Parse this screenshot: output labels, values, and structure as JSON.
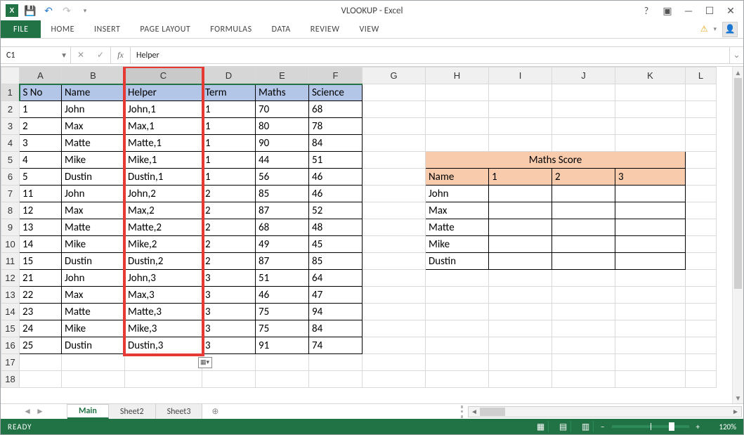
{
  "title": "VLOOKUP - Excel",
  "ribbon_tabs": {
    "file": "FILE",
    "home": "HOME",
    "insert": "INSERT",
    "page": "PAGE LAYOUT",
    "formulas": "FORMULAS",
    "data": "DATA",
    "review": "REVIEW",
    "view": "VIEW"
  },
  "name_box": "C1",
  "formula_bar": "Helper",
  "columns": [
    "A",
    "B",
    "C",
    "D",
    "E",
    "F",
    "G",
    "H",
    "I",
    "J",
    "K",
    "L"
  ],
  "row_count": 18,
  "dt": {
    "headers": {
      "sno": "S No",
      "name": "Name",
      "helper": "Helper",
      "term": "Term",
      "maths": "Maths",
      "science": "Science"
    },
    "rows": [
      {
        "sno": 1,
        "name": "John",
        "helper": "John,1",
        "term": 1,
        "maths": 70,
        "science": 68
      },
      {
        "sno": 2,
        "name": "Max",
        "helper": "Max,1",
        "term": 1,
        "maths": 80,
        "science": 78
      },
      {
        "sno": 3,
        "name": "Matte",
        "helper": "Matte,1",
        "term": 1,
        "maths": 90,
        "science": 84
      },
      {
        "sno": 4,
        "name": "Mike",
        "helper": "Mike,1",
        "term": 1,
        "maths": 44,
        "science": 51
      },
      {
        "sno": 5,
        "name": "Dustin",
        "helper": "Dustin,1",
        "term": 1,
        "maths": 56,
        "science": 46
      },
      {
        "sno": 11,
        "name": "John",
        "helper": "John,2",
        "term": 2,
        "maths": 85,
        "science": 46
      },
      {
        "sno": 12,
        "name": "Max",
        "helper": "Max,2",
        "term": 2,
        "maths": 87,
        "science": 52
      },
      {
        "sno": 13,
        "name": "Matte",
        "helper": "Matte,2",
        "term": 2,
        "maths": 68,
        "science": 48
      },
      {
        "sno": 14,
        "name": "Mike",
        "helper": "Mike,2",
        "term": 2,
        "maths": 49,
        "science": 45
      },
      {
        "sno": 15,
        "name": "Dustin",
        "helper": "Dustin,2",
        "term": 2,
        "maths": 87,
        "science": 85
      },
      {
        "sno": 21,
        "name": "John",
        "helper": "John,3",
        "term": 3,
        "maths": 51,
        "science": 64
      },
      {
        "sno": 22,
        "name": "Max",
        "helper": "Max,3",
        "term": 3,
        "maths": 46,
        "science": 47
      },
      {
        "sno": 23,
        "name": "Matte",
        "helper": "Matte,3",
        "term": 3,
        "maths": 75,
        "science": 94
      },
      {
        "sno": 24,
        "name": "Mike",
        "helper": "Mike,3",
        "term": 3,
        "maths": 75,
        "science": 84
      },
      {
        "sno": 25,
        "name": "Dustin",
        "helper": "Dustin,3",
        "term": 3,
        "maths": 91,
        "science": 74
      }
    ]
  },
  "lookup": {
    "title": "Maths Score",
    "name_hdr": "Name",
    "cols": [
      "1",
      "2",
      "3"
    ],
    "names": [
      "John",
      "Max",
      "Matte",
      "Mike",
      "Dustin"
    ]
  },
  "sheets": {
    "active": "Main",
    "others": [
      "Sheet2",
      "Sheet3"
    ]
  },
  "status": {
    "ready": "READY",
    "zoom": "120%"
  }
}
